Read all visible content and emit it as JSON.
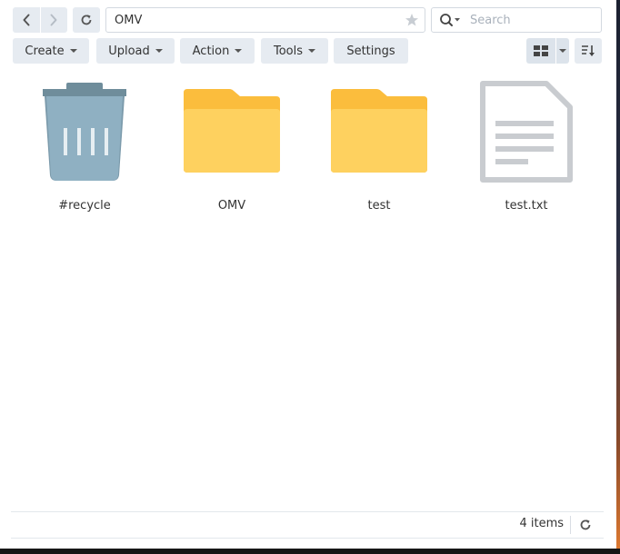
{
  "nav": {
    "back_icon": "chevron-left-icon",
    "forward_icon": "chevron-right-icon",
    "refresh_icon": "refresh-icon"
  },
  "path": {
    "value": "OMV",
    "favorite_icon": "star-icon"
  },
  "search": {
    "placeholder": "Search",
    "icon": "search-icon"
  },
  "toolbar": {
    "create_label": "Create",
    "upload_label": "Upload",
    "action_label": "Action",
    "tools_label": "Tools",
    "settings_label": "Settings",
    "view_icon": "grid-view-icon",
    "sort_icon": "sort-icon"
  },
  "files": [
    {
      "name": "#recycle",
      "icon": "recycle-bin-icon"
    },
    {
      "name": "OMV",
      "icon": "folder-icon"
    },
    {
      "name": "test",
      "icon": "folder-icon"
    },
    {
      "name": "test.txt",
      "icon": "text-file-icon"
    }
  ],
  "status": {
    "count_text": "4 items",
    "refresh_icon": "refresh-icon"
  },
  "colors": {
    "button_bg": "#e6ebf1",
    "folder_back": "#fbbd3d",
    "folder_front": "#fed15f",
    "bin": "#8fb0c2",
    "file_outline": "#c9ccd0"
  }
}
